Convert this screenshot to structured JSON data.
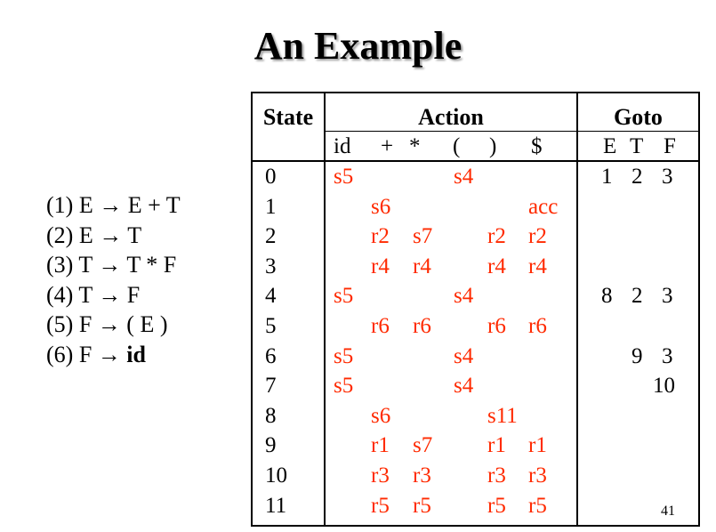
{
  "title": "An Example",
  "grammar": [
    {
      "num": "(1)",
      "lhs": "E",
      "arrow": "→",
      "rhs": "E + T",
      "bold_rhs": ""
    },
    {
      "num": "(2)",
      "lhs": "E",
      "arrow": "→",
      "rhs": "T",
      "bold_rhs": ""
    },
    {
      "num": "(3)",
      "lhs": "T",
      "arrow": "→",
      "rhs": "T * F",
      "bold_rhs": ""
    },
    {
      "num": "(4)",
      "lhs": "T",
      "arrow": "→",
      "rhs": "F",
      "bold_rhs": ""
    },
    {
      "num": "(5)",
      "lhs": "F",
      "arrow": "→",
      "rhs": "( E )",
      "bold_rhs": ""
    },
    {
      "num": "(6)",
      "lhs": "F",
      "arrow": "→",
      "rhs": "",
      "bold_rhs": "id"
    }
  ],
  "table": {
    "headers": {
      "state": "State",
      "action": "Action",
      "goto": "Goto"
    },
    "action_symbols": [
      "id",
      "+",
      "*",
      "(",
      ")",
      "$"
    ],
    "goto_symbols": [
      "E",
      "T",
      "F"
    ],
    "rows": [
      {
        "state": "0",
        "action": [
          "s5",
          "",
          "",
          "s4",
          "",
          ""
        ],
        "goto": [
          "1",
          "2",
          "3"
        ]
      },
      {
        "state": "1",
        "action": [
          "",
          "s6",
          "",
          "",
          "",
          "acc"
        ],
        "goto": [
          "",
          "",
          ""
        ]
      },
      {
        "state": "2",
        "action": [
          "",
          "r2",
          "s7",
          "",
          "r2",
          "r2"
        ],
        "goto": [
          "",
          "",
          ""
        ]
      },
      {
        "state": "3",
        "action": [
          "",
          "r4",
          "r4",
          "",
          "r4",
          "r4"
        ],
        "goto": [
          "",
          "",
          ""
        ]
      },
      {
        "state": "4",
        "action": [
          "s5",
          "",
          "",
          "s4",
          "",
          ""
        ],
        "goto": [
          "8",
          "2",
          "3"
        ]
      },
      {
        "state": "5",
        "action": [
          "",
          "r6",
          "r6",
          "",
          "r6",
          "r6"
        ],
        "goto": [
          "",
          "",
          ""
        ]
      },
      {
        "state": "6",
        "action": [
          "s5",
          "",
          "",
          "s4",
          "",
          ""
        ],
        "goto": [
          "",
          "9",
          "3"
        ]
      },
      {
        "state": "7",
        "action": [
          "s5",
          "",
          "",
          "s4",
          "",
          ""
        ],
        "goto": [
          "",
          "",
          "10"
        ]
      },
      {
        "state": "8",
        "action": [
          "",
          "s6",
          "",
          "",
          "s11",
          ""
        ],
        "goto": [
          "",
          "",
          ""
        ]
      },
      {
        "state": "9",
        "action": [
          "",
          "r1",
          "s7",
          "",
          "r1",
          "r1"
        ],
        "goto": [
          "",
          "",
          ""
        ]
      },
      {
        "state": "10",
        "action": [
          "",
          "r3",
          "r3",
          "",
          "r3",
          "r3"
        ],
        "goto": [
          "",
          "",
          ""
        ]
      },
      {
        "state": "11",
        "action": [
          "",
          "r5",
          "r5",
          "",
          "r5",
          "r5"
        ],
        "goto": [
          "",
          "",
          ""
        ]
      }
    ]
  },
  "page_number": "41",
  "colors": {
    "action_entries": "#ff2a00",
    "text": "#000000"
  }
}
